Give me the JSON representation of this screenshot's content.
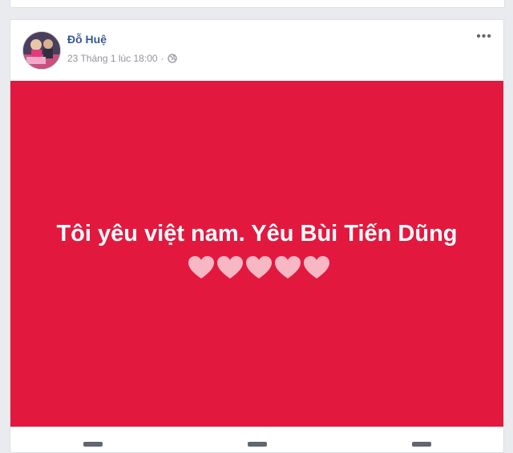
{
  "post": {
    "author": "Đỗ Huệ",
    "timestamp": "23 Tháng 1 lúc 18:00",
    "separator": "·",
    "more_label": "•••",
    "privacy_icon": "globe-icon",
    "status_text": "Tôi yêu việt nam. Yêu Bùi Tiến Dũng",
    "heart_count": 5
  },
  "colors": {
    "banner_background": "#e3183f",
    "author_link": "#365899",
    "meta_text": "#90949c",
    "heart_fill": "#f7b8c4"
  }
}
